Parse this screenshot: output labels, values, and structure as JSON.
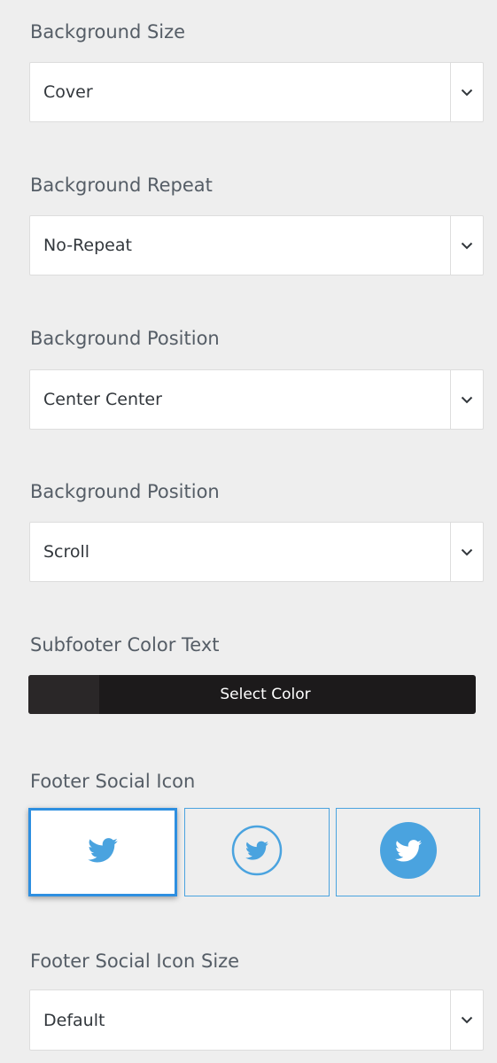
{
  "background_size": {
    "label": "Background Size",
    "value": "Cover"
  },
  "background_repeat": {
    "label": "Background Repeat",
    "value": "No-Repeat"
  },
  "background_position": {
    "label": "Background Position",
    "value": "Center Center"
  },
  "background_attachment": {
    "label": "Background Position",
    "value": "Scroll"
  },
  "subfooter_color_text": {
    "label": "Subfooter Color Text",
    "button_label": "Select Color",
    "current_color": "#1c1a1b"
  },
  "footer_social_icon": {
    "label": "Footer Social Icon",
    "options": [
      {
        "icon": "twitter-icon",
        "style": "plain",
        "selected": true
      },
      {
        "icon": "twitter-circle-outline-icon",
        "style": "circle-outline",
        "selected": false
      },
      {
        "icon": "twitter-circle-filled-icon",
        "style": "circle-filled",
        "selected": false
      }
    ],
    "accent_color": "#4aa3df"
  },
  "footer_social_icon_size": {
    "label": "Footer Social Icon Size",
    "value": "Default"
  }
}
